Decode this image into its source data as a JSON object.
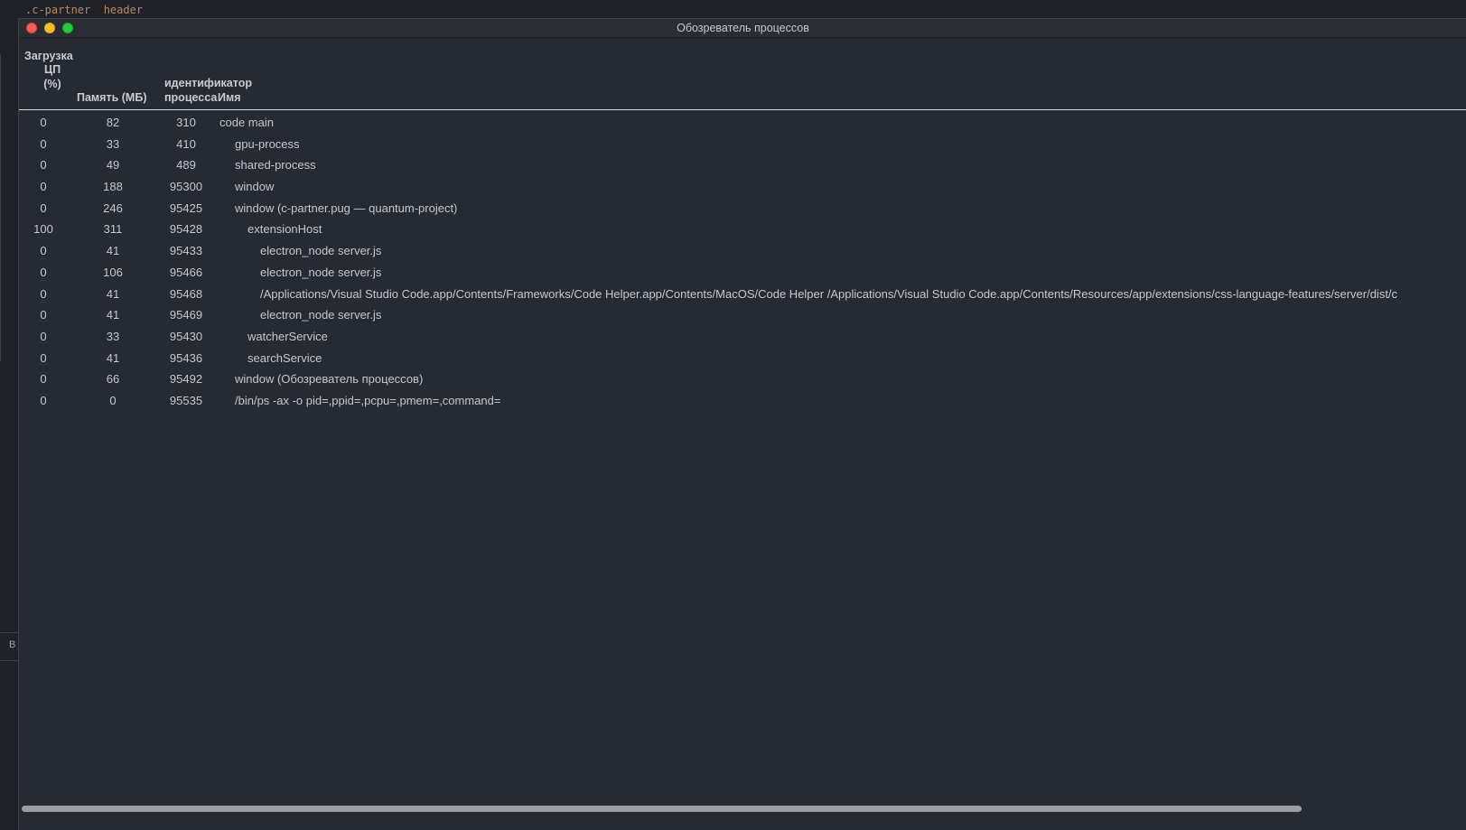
{
  "background": {
    "code_snippet": ".c-partner  header",
    "strip_letter": "B"
  },
  "window": {
    "title": "Обозреватель процессов"
  },
  "table": {
    "headers": {
      "cpu_line1": "Загрузка",
      "cpu_line2": "ЦП",
      "cpu_line3": "(%)",
      "memory": "Память (МБ)",
      "pid_line1": "идентификатор",
      "pid_line2": "процесса",
      "name": "Имя"
    },
    "rows": [
      {
        "cpu": "0",
        "mem": "82",
        "pid": "310",
        "name": "code main",
        "depth": 0
      },
      {
        "cpu": "0",
        "mem": "33",
        "pid": "410",
        "name": "gpu-process",
        "depth": 1
      },
      {
        "cpu": "0",
        "mem": "49",
        "pid": "489",
        "name": "shared-process",
        "depth": 1
      },
      {
        "cpu": "0",
        "mem": "188",
        "pid": "95300",
        "name": "window",
        "depth": 1
      },
      {
        "cpu": "0",
        "mem": "246",
        "pid": "95425",
        "name": "window (c-partner.pug — quantum-project)",
        "depth": 1
      },
      {
        "cpu": "100",
        "mem": "311",
        "pid": "95428",
        "name": "extensionHost",
        "depth": 2
      },
      {
        "cpu": "0",
        "mem": "41",
        "pid": "95433",
        "name": "electron_node server.js",
        "depth": 3
      },
      {
        "cpu": "0",
        "mem": "106",
        "pid": "95466",
        "name": "electron_node server.js",
        "depth": 3
      },
      {
        "cpu": "0",
        "mem": "41",
        "pid": "95468",
        "name": "/Applications/Visual Studio Code.app/Contents/Frameworks/Code Helper.app/Contents/MacOS/Code Helper /Applications/Visual Studio Code.app/Contents/Resources/app/extensions/css-language-features/server/dist/c",
        "depth": 3
      },
      {
        "cpu": "0",
        "mem": "41",
        "pid": "95469",
        "name": "electron_node server.js",
        "depth": 3
      },
      {
        "cpu": "0",
        "mem": "33",
        "pid": "95430",
        "name": "watcherService",
        "depth": 2
      },
      {
        "cpu": "0",
        "mem": "41",
        "pid": "95436",
        "name": "searchService",
        "depth": 2
      },
      {
        "cpu": "0",
        "mem": "66",
        "pid": "95492",
        "name": "window (Обозреватель процессов)",
        "depth": 1
      },
      {
        "cpu": "0",
        "mem": "0",
        "pid": "95535",
        "name": "/bin/ps -ax -o pid=,ppid=,pcpu=,pmem=,command=",
        "depth": 1
      }
    ]
  },
  "colors": {
    "window_bg": "#262a33",
    "text": "#c5c8cc",
    "close": "#fe5f57",
    "minimize": "#febc2e",
    "maximize": "#28c840"
  }
}
